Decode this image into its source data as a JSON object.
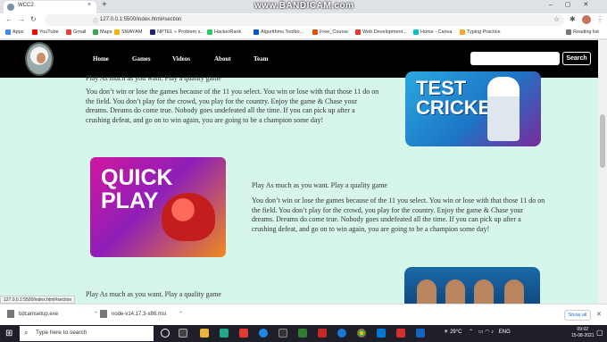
{
  "browser": {
    "tab_title": "WCC2",
    "tab_close": "×",
    "new_tab": "+",
    "recorder_watermark": "www.BANDICAM.com",
    "window_controls": "–  ▢  ✕",
    "url": "127.0.0.1:5500/index.html#section",
    "nav_back": "←",
    "nav_forward": "→",
    "nav_reload": "↻",
    "bookmarks": [
      {
        "label": "Apps",
        "icon": "apps-grid-icon",
        "color": "#4285f4"
      },
      {
        "label": "YouTube",
        "icon": "youtube-icon",
        "color": "#ff0000"
      },
      {
        "label": "Gmail",
        "icon": "gmail-icon",
        "color": "#ea4335"
      },
      {
        "label": "Maps",
        "icon": "maps-icon",
        "color": "#34a853"
      },
      {
        "label": "SWAYAM",
        "icon": "swayam-icon",
        "color": "#f4b400"
      },
      {
        "label": "NPTEL » Problem s...",
        "icon": "nptel-icon",
        "color": "#1a237e"
      },
      {
        "label": "HackerRank",
        "icon": "hackerrank-icon",
        "color": "#2ec866"
      },
      {
        "label": "Algorithms Toolbo...",
        "icon": "coursera-icon",
        "color": "#0056d2"
      },
      {
        "label": "Free_Course",
        "icon": "course-icon",
        "color": "#e65100"
      },
      {
        "label": "Web Development...",
        "icon": "web-dev-icon",
        "color": "#e53935"
      },
      {
        "label": "Home - Canva",
        "icon": "canva-icon",
        "color": "#00c4cc"
      },
      {
        "label": "Typing Practice",
        "icon": "typing-icon",
        "color": "#f9a825"
      }
    ],
    "reading_list": "Reading list",
    "status_url": "127.0.0.1:5500/index.html#section"
  },
  "site": {
    "nav": [
      "Home",
      "Games",
      "Videos",
      "About",
      "Team"
    ],
    "search": {
      "placeholder": "",
      "button": "Search"
    },
    "sections": [
      {
        "heading": "Play As much as you want. Play a quality game",
        "body": "You don’t win or lose the games because of the 11 you select. You win or lose with that those 11 do on the field. You don’t play for the crowd, you play for the country. Enjoy the game & Chase your dreams. Dreams do come true. Nobody goes undefeated all the time. If you can pick up after a crushing defeat, and go on to win again, you are going to be a champion some day!",
        "image_text": "TEST CRICKET"
      },
      {
        "heading": "Play As much as you want. Play a quality game",
        "body": "You don’t win or lose the games because of the 11 you select. You win or lose with that those 11 do on the field. You don’t play for the crowd, you play for the country. Enjoy the game & Chase your dreams. Dreams do come true. Nobody goes undefeated all the time. If you can pick up after a crushing defeat, and go on to win again, you are going to be a champion some day!",
        "image_text": "QUICK PLAY"
      },
      {
        "heading": "Play As much as you want. Play a quality game"
      }
    ]
  },
  "downloads": {
    "items": [
      "bdcamsetup.exe",
      "node-v14.17.3-x86.msi"
    ],
    "show_all": "Show all",
    "close": "✕"
  },
  "taskbar": {
    "search_placeholder": "Type here to search",
    "weather": "29°C",
    "language": "ENG",
    "time": "09:02",
    "date": "15-08-2021"
  },
  "colors": {
    "page_background": "#d6f5eb",
    "navbar": "#000000",
    "link_blue": "#1a73e8"
  }
}
